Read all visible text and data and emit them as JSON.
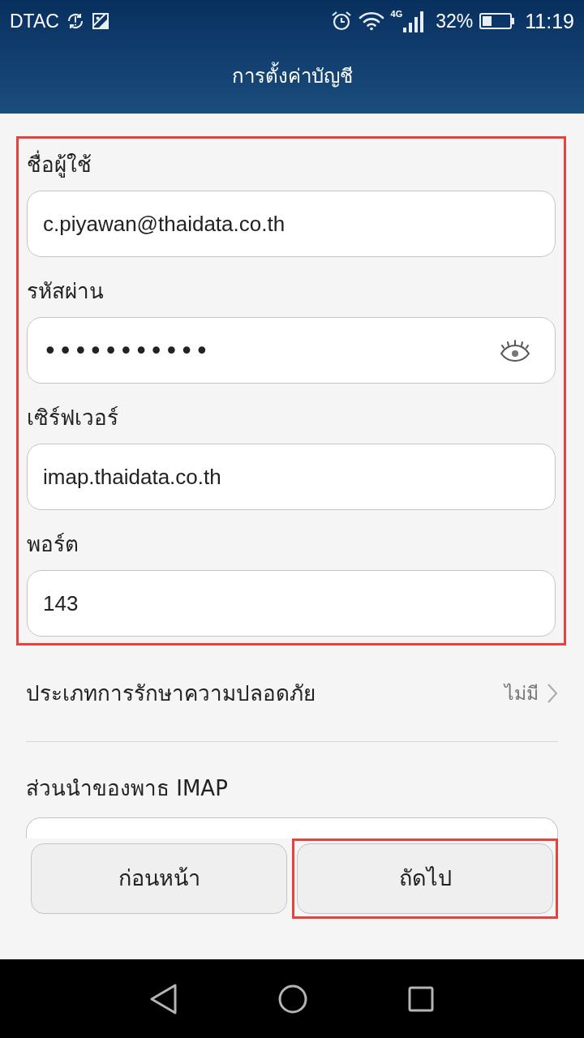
{
  "status_bar": {
    "carrier": "DTAC",
    "network": "4G",
    "battery": "32%",
    "time": "11:19"
  },
  "title_bar": {
    "title": "การตั้งค่าบัญชี"
  },
  "account_form": {
    "highlighted": true,
    "fields": [
      {
        "kind": "text",
        "label": "ชื่อผู้ใช้",
        "value": "c.piyawan@thaidata.co.th"
      },
      {
        "kind": "password",
        "label": "รหัสผ่าน",
        "value": "•••••••••••"
      },
      {
        "kind": "text",
        "label": "เซิร์ฟเวอร์",
        "value": "imap.thaidata.co.th"
      },
      {
        "kind": "text",
        "label": "พอร์ต",
        "value": "143"
      }
    ]
  },
  "security_type": {
    "label": "ประเภทการรักษาความปลอดภัย",
    "value": "ไม่มี"
  },
  "imap_path_prefix": {
    "label": "ส่วนนำของพาธ IMAP"
  },
  "buttons": [
    {
      "label": "ก่อนหน้า",
      "highlighted": false
    },
    {
      "label": "ถัดไป",
      "highlighted": true
    }
  ]
}
